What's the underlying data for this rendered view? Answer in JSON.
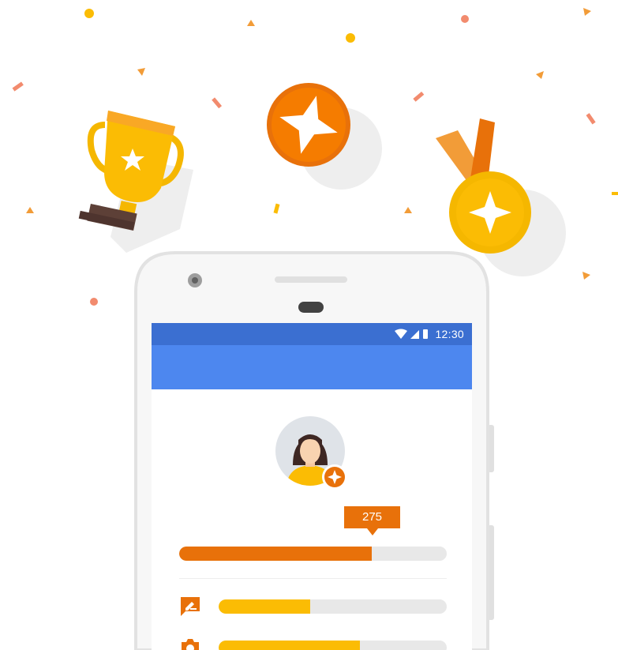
{
  "status_bar": {
    "time": "12:30",
    "icons": [
      "wifi-icon",
      "signal-icon",
      "battery-icon"
    ]
  },
  "score": {
    "value": "275",
    "progress_fraction": 0.72
  },
  "contribution_rows": [
    {
      "icon": "edit-review-icon",
      "progress_fraction": 0.4
    },
    {
      "icon": "camera-icon",
      "progress_fraction": 0.62
    }
  ],
  "colors": {
    "status_bar": "#3b6fd1",
    "app_bar": "#4d87ef",
    "accent_orange": "#e8710a",
    "accent_yellow": "#fbbc04",
    "track_gray": "#e8e8e8"
  },
  "decorations": [
    "trophy-icon",
    "star-badge-icon",
    "medal-icon",
    "confetti"
  ]
}
